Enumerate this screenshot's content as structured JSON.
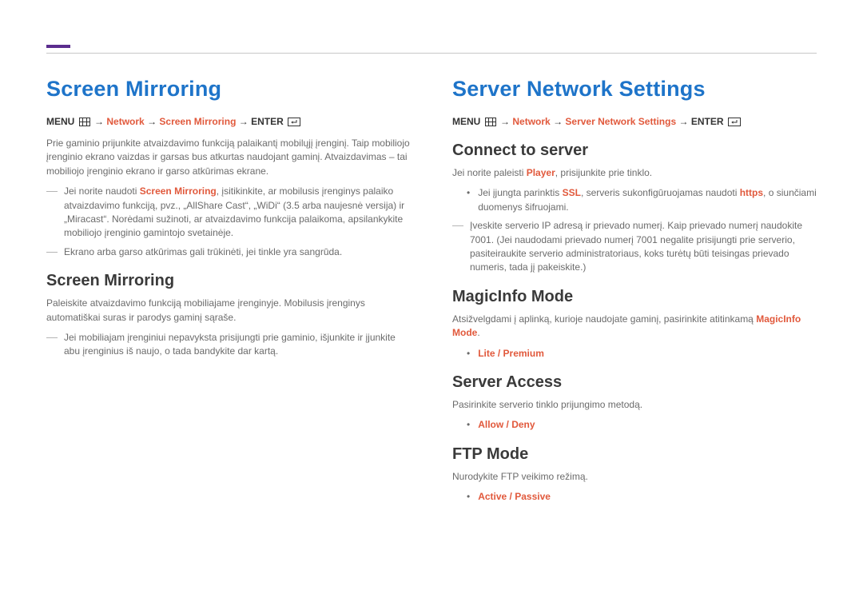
{
  "left": {
    "title": "Screen Mirroring",
    "menu_path": {
      "menu": "MENU",
      "net": "Network",
      "item": "Screen Mirroring",
      "enter": "ENTER"
    },
    "intro": "Prie gaminio prijunkite atvaizdavimo funkciją palaikantį mobilųjį įrenginį. Taip mobiliojo įrenginio ekrano vaizdas ir garsas bus atkurtas naudojant gaminį. Atvaizdavimas – tai mobiliojo įrenginio ekrano ir garso atkūrimas ekrane.",
    "note1_pre": "Jei norite naudoti ",
    "note1_em": "Screen Mirroring",
    "note1_post": ", įsitikinkite, ar mobilusis įrenginys palaiko atvaizdavimo funkciją, pvz., „AllShare Cast“, „WiDi“ (3.5 arba naujesnė versija) ir „Miracast“. Norėdami sužinoti, ar atvaizdavimo funkcija palaikoma, apsilankykite mobiliojo įrenginio gamintojo svetainėje.",
    "note2": "Ekrano arba garso atkūrimas gali trūkinėti, jei tinkle yra sangrūda.",
    "h2": "Screen Mirroring",
    "p2": "Paleiskite atvaizdavimo funkciją mobiliajame įrenginyje. Mobilusis įrenginys automatiškai suras ir parodys gaminį sąraše.",
    "note3": "Jei mobiliajam įrenginiui nepavyksta prisijungti prie gaminio, išjunkite ir įjunkite abu įrenginius iš naujo, o tada bandykite dar kartą."
  },
  "right": {
    "title": "Server Network Settings",
    "menu_path": {
      "menu": "MENU",
      "net": "Network",
      "item": "Server Network Settings",
      "enter": "ENTER"
    },
    "connect": {
      "h": "Connect to server",
      "p_pre": "Jei norite paleisti ",
      "p_em": "Player",
      "p_post": ", prisijunkite prie tinklo.",
      "b1_pre": "Jei įjungta parinktis ",
      "b1_em1": "SSL",
      "b1_mid": ", serveris sukonfigūruojamas naudoti ",
      "b1_em2": "https",
      "b1_post": ", o siunčiami duomenys šifruojami.",
      "d1": "Įveskite serverio IP adresą ir prievado numerį. Kaip prievado numerį naudokite 7001. (Jei naudodami prievado numerį 7001 negalite prisijungti prie serverio, pasiteiraukite serverio administratoriaus, koks turėtų būti teisingas prievado numeris, tada jį pakeiskite.)"
    },
    "magic": {
      "h": "MagicInfo Mode",
      "p_pre": "Atsižvelgdami į aplinką, kurioje naudojate gaminį, pasirinkite atitinkamą ",
      "p_em": "MagicInfo Mode",
      "p_post": ".",
      "opt": "Lite / Premium"
    },
    "access": {
      "h": "Server Access",
      "p": "Pasirinkite serverio tinklo prijungimo metodą.",
      "opt": "Allow / Deny"
    },
    "ftp": {
      "h": "FTP Mode",
      "p": "Nurodykite FTP veikimo režimą.",
      "opt": "Active / Passive"
    }
  }
}
